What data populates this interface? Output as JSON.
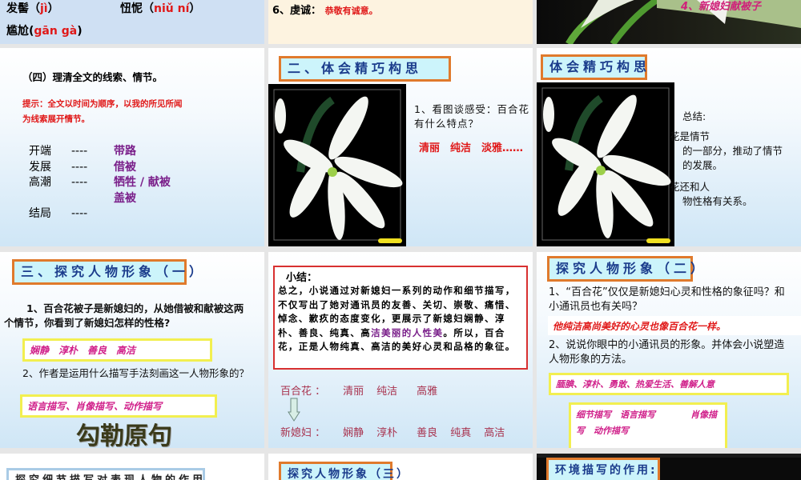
{
  "slides": {
    "s1": {
      "l1a": "发髻（",
      "l1a_py": "jì",
      "l1a_end": "）",
      "l1b": "忸怩（",
      "l1b_py": "niǔ ní",
      "l1b_end": "）",
      "l2": "尴尬(",
      "l2_py": "gān gà",
      "l2_end": ")"
    },
    "s2": {
      "num": "6、虔诚：",
      "def": "恭敬有诚意。"
    },
    "s3": {
      "caption": "4、新媳妇献被子"
    },
    "s4": {
      "title": "（四）理清全文的线索、情节。",
      "hint1": "提示：全文以时间为顺序，以我的所见所闻",
      "hint2": "为线索展开情节。",
      "plot": [
        {
          "label": "开端",
          "dash": "----",
          "value": "带路"
        },
        {
          "label": "发展",
          "dash": "----",
          "value": "借被"
        },
        {
          "label": "高潮",
          "dash": "----",
          "value": "牺牲 / 献被"
        },
        {
          "label": "",
          "dash": "",
          "value": "盖被"
        },
        {
          "label": "结局",
          "dash": "----",
          "value": ""
        }
      ]
    },
    "s5": {
      "title": "二、体会精巧构思",
      "q": "1、看图谈感受：百合花有什么特点？",
      "answer": "清丽　纯洁　淡雅……"
    },
    "s6": {
      "title": "体会精巧构思",
      "summary": "总结:",
      "l1": "花是情节",
      "l2": "的一部分，推动了情节",
      "l3": "的发展。",
      "l4": "花还和人",
      "l5": "物性格有关系。"
    },
    "s7": {
      "title": "三、探究人物形象（一）",
      "q1": "1、百合花被子是新媳妇的，从她借被和献被这两个情节，你看到了新媳妇怎样的性格?",
      "a1": "娴静　淳朴　善良　高洁",
      "q2": "2、作者是运用什么描写手法刻画这一人物形象的？",
      "a2": "语言描写、肖像描写、动作描写",
      "big": "勾勒原句"
    },
    "s8": {
      "head": "小结：",
      "para1": "总之，小说通过对新媳妇一系列的动作和细节描写，不仅写出了她对通讯员的友善、关切、崇敬、痛惜、悼念、歉疚的态度变化，更展示了新媳妇娴静、淳朴、善良、纯真、高",
      "para_purple": "洁美丽的人性美",
      "para2": "。所以，百合花，正是人物纯真、高洁的美好心灵和品格的象征。",
      "row1_label": "百合花 ：",
      "row1": [
        "清丽",
        "纯洁",
        "高雅"
      ],
      "row2_label": "新媳妇 ：",
      "row2": [
        "娴静",
        "淳朴",
        "善良",
        "纯真",
        "高洁"
      ]
    },
    "s9": {
      "title": "探究人物形象（二）",
      "q1": "1、“百合花”仅仅是新媳妇心灵和性格的象征吗？和小通讯员也有关吗？",
      "a1": "他纯洁高尚美好的心灵也像百合花一样。",
      "q2": "2、说说你眼中的小通讯员的形象。并体会小说塑造人物形象的方法。",
      "a2": "腼腆、淳朴、勇敢、热爱生活、善解人意",
      "a3": "细节描写　语言描写　　　　肖像描写　动作描写"
    },
    "s10": {
      "title": "探究细节描写对表现人物的作用"
    },
    "s11": {
      "title": "探究人物形象（三）"
    },
    "s12": {
      "title": "环境描写的作用:"
    }
  }
}
